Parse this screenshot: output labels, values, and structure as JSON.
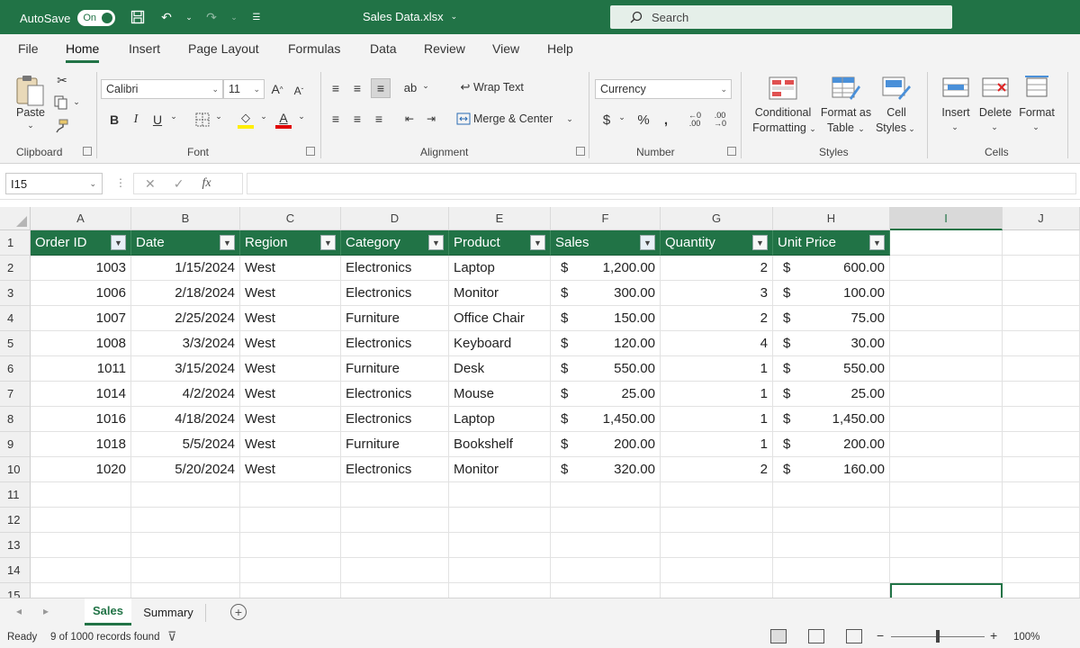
{
  "titlebar": {
    "autosave_label": "AutoSave",
    "autosave_state": "On",
    "doc_title": "Sales Data.xlsx",
    "search_placeholder": "Search"
  },
  "ribbon_tabs": [
    "File",
    "Home",
    "Insert",
    "Page Layout",
    "Formulas",
    "Data",
    "Review",
    "View",
    "Help"
  ],
  "active_tab": "Home",
  "ribbon": {
    "clipboard": {
      "label": "Clipboard",
      "paste": "Paste"
    },
    "font": {
      "label": "Font",
      "name": "Calibri",
      "size": "11",
      "bold": "B",
      "italic": "I",
      "underline": "U"
    },
    "alignment": {
      "label": "Alignment",
      "wrap_text": "Wrap Text",
      "merge_center": "Merge & Center"
    },
    "number": {
      "label": "Number",
      "format": "Currency",
      "dollar": "$",
      "percent": "%",
      "comma": "ܷ"
    },
    "styles": {
      "label": "Styles",
      "conditional_1": "Conditional",
      "conditional_2": "Formatting",
      "format_table_1": "Format as",
      "format_table_2": "Table",
      "cell_styles_1": "Cell",
      "cell_styles_2": "Styles"
    },
    "cells": {
      "label": "Cells",
      "insert": "Insert",
      "delete": "Delete",
      "format": "Format"
    }
  },
  "formula_bar": {
    "name_box": "I15",
    "fx": "fx",
    "value": ""
  },
  "columns": [
    "A",
    "B",
    "C",
    "D",
    "E",
    "F",
    "G",
    "H",
    "I",
    "J"
  ],
  "table": {
    "headers": [
      "Order ID",
      "Date",
      "Region",
      "Category",
      "Product",
      "Sales",
      "Quantity",
      "Unit Price"
    ],
    "rows": [
      {
        "row": "2",
        "id": "1003",
        "date": "1/15/2024",
        "region": "West",
        "category": "Electronics",
        "product": "Laptop",
        "sales": "1,200.00",
        "qty": "2",
        "price": "600.00"
      },
      {
        "row": "3",
        "id": "1006",
        "date": "2/18/2024",
        "region": "West",
        "category": "Electronics",
        "product": "Monitor",
        "sales": "300.00",
        "qty": "3",
        "price": "100.00"
      },
      {
        "row": "4",
        "id": "1007",
        "date": "2/25/2024",
        "region": "West",
        "category": "Furniture",
        "product": "Office Chair",
        "sales": "150.00",
        "qty": "2",
        "price": "75.00"
      },
      {
        "row": "5",
        "id": "1008",
        "date": "3/3/2024",
        "region": "West",
        "category": "Electronics",
        "product": "Keyboard",
        "sales": "120.00",
        "qty": "4",
        "price": "30.00"
      },
      {
        "row": "6",
        "id": "1011",
        "date": "3/15/2024",
        "region": "West",
        "category": "Furniture",
        "product": "Desk",
        "sales": "550.00",
        "qty": "1",
        "price": "550.00"
      },
      {
        "row": "7",
        "id": "1014",
        "date": "4/2/2024",
        "region": "West",
        "category": "Electronics",
        "product": "Mouse",
        "sales": "25.00",
        "qty": "1",
        "price": "25.00"
      },
      {
        "row": "8",
        "id": "1016",
        "date": "4/18/2024",
        "region": "West",
        "category": "Electronics",
        "product": "Laptop",
        "sales": "1,450.00",
        "qty": "1",
        "price": "1,450.00"
      },
      {
        "row": "9",
        "id": "1018",
        "date": "5/5/2024",
        "region": "West",
        "category": "Furniture",
        "product": "Bookshelf",
        "sales": "200.00",
        "qty": "1",
        "price": "200.00"
      },
      {
        "row": "10",
        "id": "1020",
        "date": "5/20/2024",
        "region": "West",
        "category": "Electronics",
        "product": "Monitor",
        "sales": "320.00",
        "qty": "2",
        "price": "160.00"
      }
    ],
    "currency_symbol": "$",
    "header_row": "1",
    "empty_rows": [
      "11",
      "12",
      "13",
      "14",
      "15"
    ]
  },
  "sheets": [
    "Sales",
    "Summary"
  ],
  "active_sheet": "Sales",
  "status": {
    "ready": "Ready",
    "records": "9 of 1000 records found",
    "zoom": "100%"
  },
  "colors": {
    "accent": "#217346",
    "header_fill": "#217346"
  }
}
